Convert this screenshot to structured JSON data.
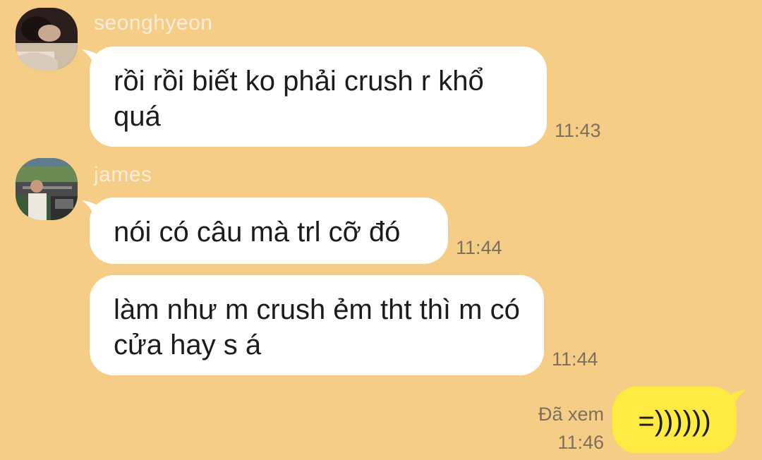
{
  "colors": {
    "background": "#f5cd86",
    "incoming_bubble": "#ffffff",
    "outgoing_bubble": "#fdea42",
    "sender_name": "#faeedb",
    "timestamp": "#7d6f5b"
  },
  "messages": [
    {
      "sender": "seonghyeon",
      "avatar_icon": "profile-photo-person-lying",
      "bubbles": [
        {
          "text": "rồi rồi biết ko phải crush r khổ quá",
          "time": "11:43"
        }
      ]
    },
    {
      "sender": "james",
      "avatar_icon": "profile-photo-stadium",
      "bubbles": [
        {
          "text": "nói có câu mà trl cỡ đó",
          "time": "11:44"
        },
        {
          "text": "làm như m crush ẻm tht thì m có cửa hay s á",
          "time": "11:44"
        }
      ]
    }
  ],
  "outgoing": {
    "text": "=))))))",
    "status": "Đã xem",
    "time": "11:46"
  }
}
